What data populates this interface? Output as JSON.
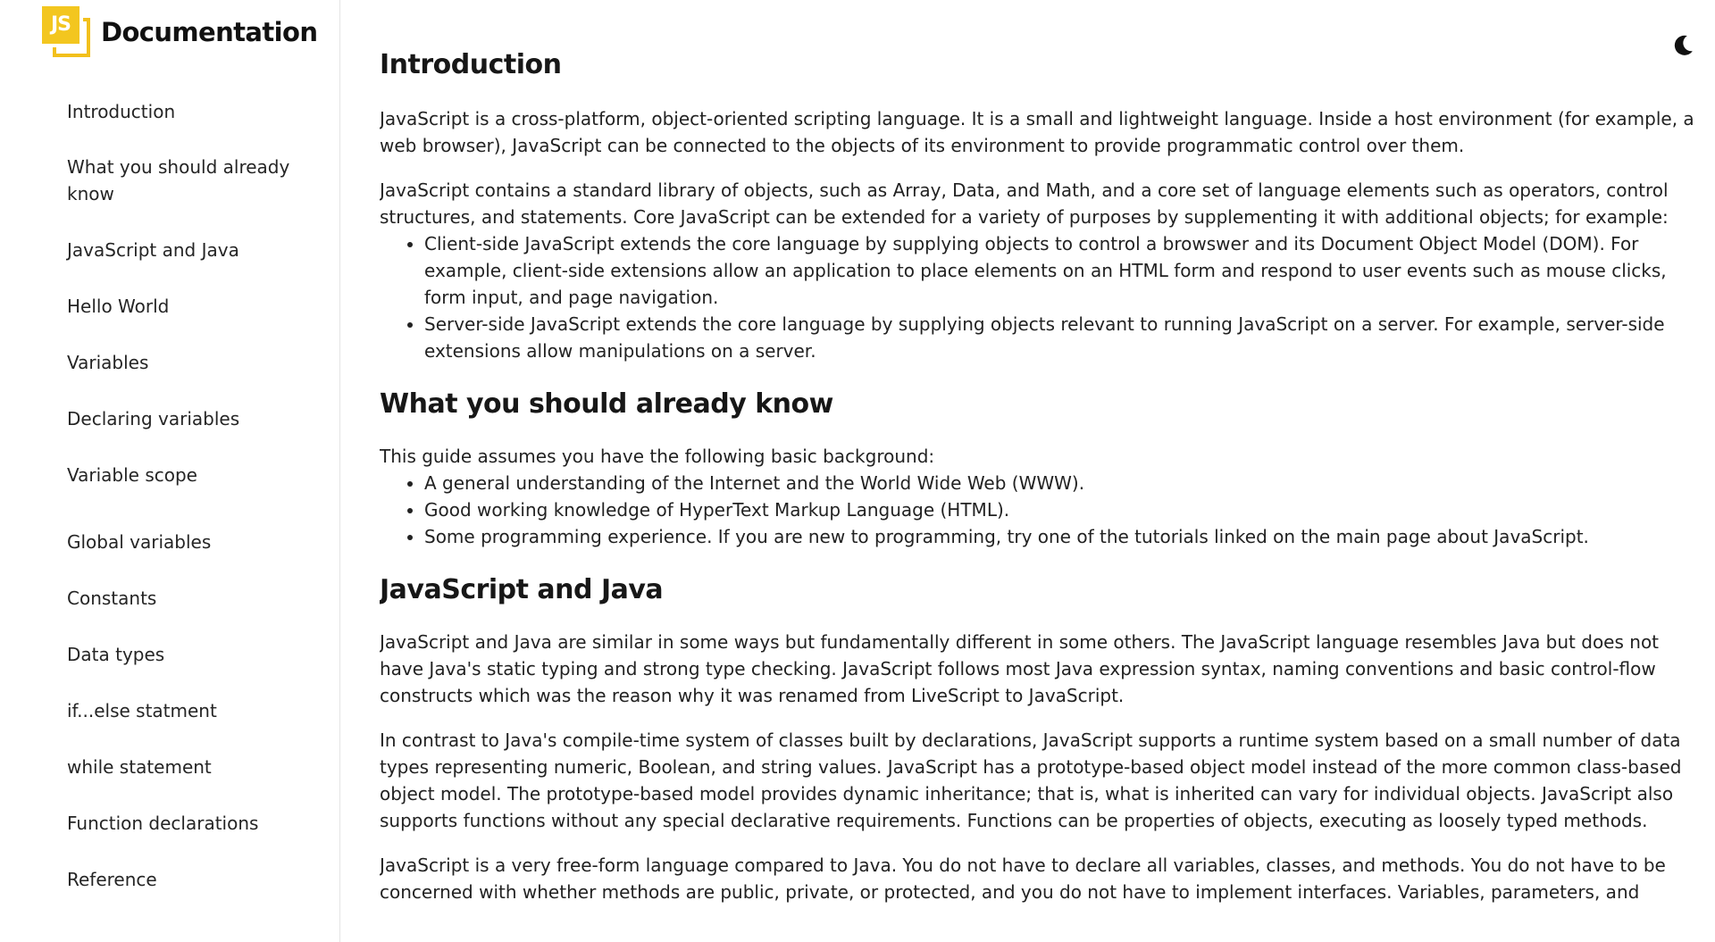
{
  "sidebar": {
    "brand": {
      "logo_text": "JS",
      "title": "Documentation"
    },
    "items": [
      {
        "label": "Introduction"
      },
      {
        "label": "What you should already know"
      },
      {
        "label": "JavaScript and Java"
      },
      {
        "label": "Hello World"
      },
      {
        "label": "Variables"
      },
      {
        "label": "Declaring variables"
      },
      {
        "label": "Variable scope"
      },
      {
        "label": "Global variables"
      },
      {
        "label": "Constants"
      },
      {
        "label": "Data types"
      },
      {
        "label": "if...else statment"
      },
      {
        "label": "while statement"
      },
      {
        "label": "Function declarations"
      },
      {
        "label": "Reference"
      }
    ]
  },
  "header": {
    "theme_toggle_icon": "moon-icon"
  },
  "main": {
    "sections": {
      "introduction": {
        "title": "Introduction",
        "paragraphs": [
          "JavaScript is a cross-platform, object-oriented scripting language. It is a small and lightweight language. Inside a host environment (for example, a web browser), JavaScript can be connected to the objects of its environment to provide programmatic control over them.",
          "JavaScript contains a standard library of objects, such as Array, Data, and Math, and a core set of language elements such as operators, control structures, and statements. Core JavaScript can be extended for a variety of purposes by supplementing it with additional objects; for example:"
        ],
        "list": [
          "Client-side JavaScript extends the core language by supplying objects to control a browswer and its Document Object Model (DOM). For example, client-side extensions allow an application to place elements on an HTML form and respond to user events such as mouse clicks, form input, and page navigation.",
          "Server-side JavaScript extends the core language by supplying objects relevant to running JavaScript on a server. For example, server-side extensions allow manipulations on a server."
        ]
      },
      "knowledge": {
        "title": "What you should already know",
        "paragraphs": [
          "This guide assumes you have the following basic background:"
        ],
        "list": [
          "A general understanding of the Internet and the World Wide Web (WWW).",
          "Good working knowledge of HyperText Markup Language (HTML).",
          "Some programming experience. If you are new to programming, try one of the tutorials linked on the main page about JavaScript."
        ]
      },
      "java": {
        "title": "JavaScript and Java",
        "paragraphs": [
          "JavaScript and Java are similar in some ways but fundamentally different in some others. The JavaScript language resembles Java but does not have Java's static typing and strong type checking. JavaScript follows most Java expression syntax, naming conventions and basic control-flow constructs which was the reason why it was renamed from LiveScript to JavaScript.",
          "In contrast to Java's compile-time system of classes built by declarations, JavaScript supports a runtime system based on a small number of data types representing numeric, Boolean, and string values. JavaScript has a prototype-based object model instead of the more common class-based object model. The prototype-based model provides dynamic inheritance; that is, what is inherited can vary for individual objects. JavaScript also supports functions without any special declarative requirements. Functions can be properties of objects, executing as loosely typed methods.",
          "JavaScript is a very free-form language compared to Java. You do not have to declare all variables, classes, and methods. You do not have to be concerned with whether methods are public, private, or protected, and you do not have to implement interfaces. Variables, parameters, and"
        ]
      }
    }
  }
}
